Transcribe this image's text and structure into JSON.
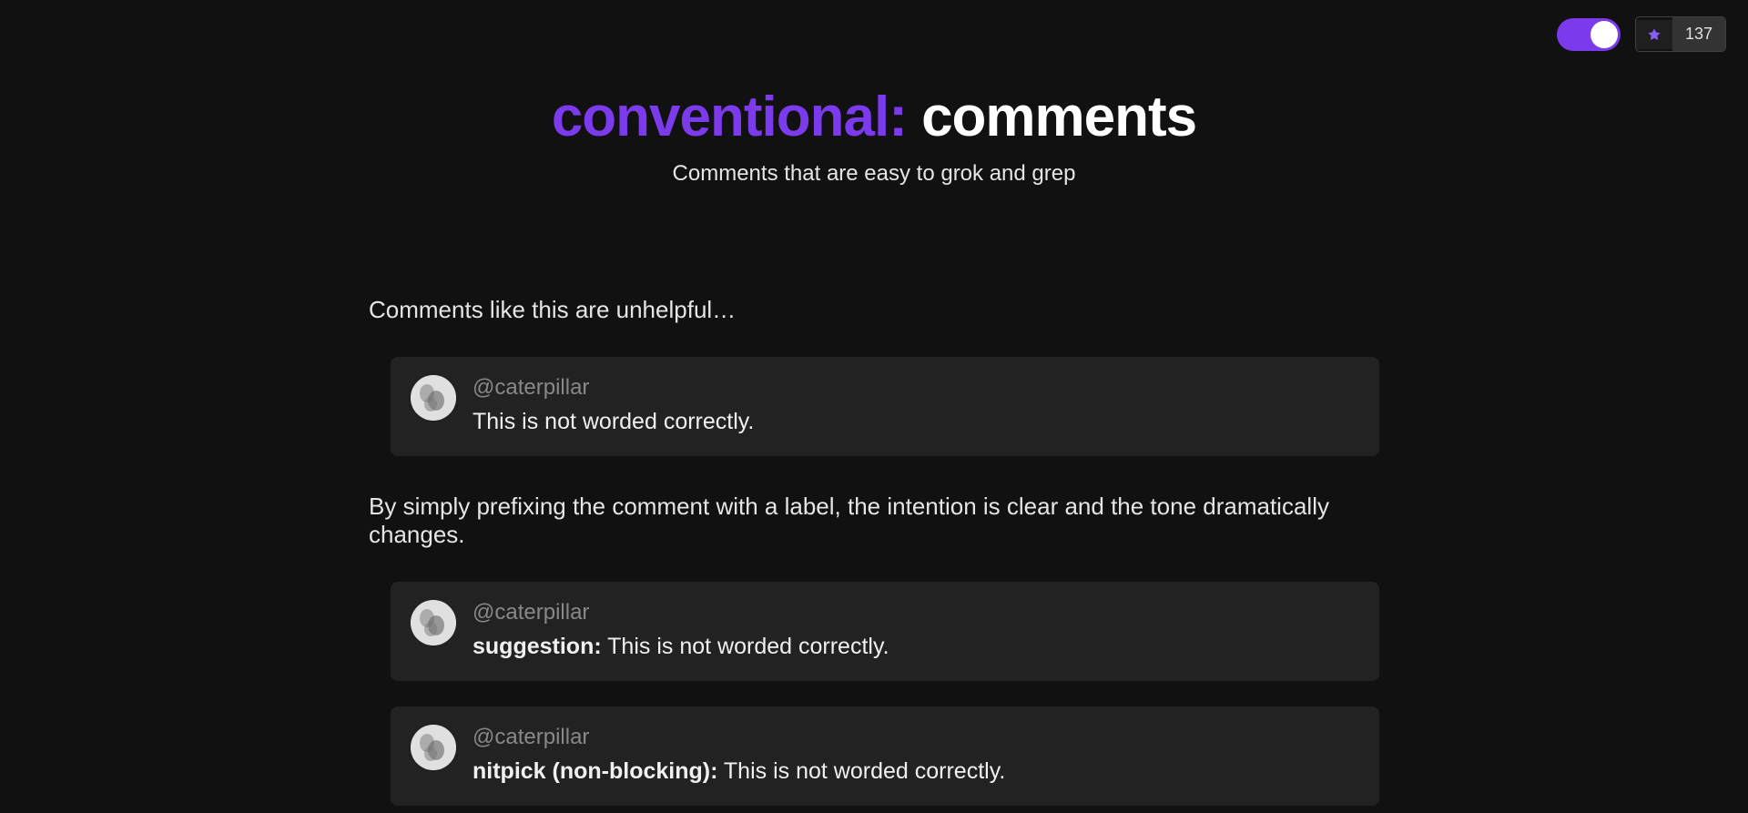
{
  "header": {
    "title_prefix": "conventional:",
    "title_suffix": " comments",
    "subtitle": "Comments that are easy to grok and grep"
  },
  "topbar": {
    "star_count": "137"
  },
  "content": {
    "intro": "Comments like this are unhelpful…",
    "description": "By simply prefixing the comment with a label, the intention is clear and the tone dramatically changes.",
    "comments": [
      {
        "username": "@caterpillar",
        "label": "",
        "text": "This is not worded correctly."
      },
      {
        "username": "@caterpillar",
        "label": "suggestion:",
        "text": " This is not worded correctly."
      },
      {
        "username": "@caterpillar",
        "label": "nitpick (non-blocking):",
        "text": " This is not worded correctly."
      }
    ]
  }
}
